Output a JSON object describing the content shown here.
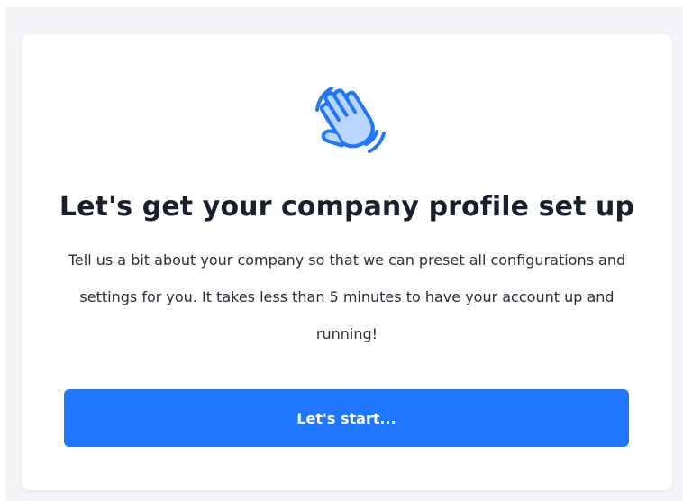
{
  "onboarding": {
    "icon": "waving-hand-icon",
    "title": "Let's get your company profile set up",
    "description": "Tell us a bit about your company so that we can preset all configurations and settings for you. It takes less than 5 minutes to have your account up and running!",
    "start_button_label": "Let's start..."
  },
  "colors": {
    "accent": "#2176ff",
    "icon_fill": "#b8d6ff",
    "page_background": "#f3f5f9",
    "card_background": "#ffffff",
    "title_text": "#1a1f2e"
  }
}
